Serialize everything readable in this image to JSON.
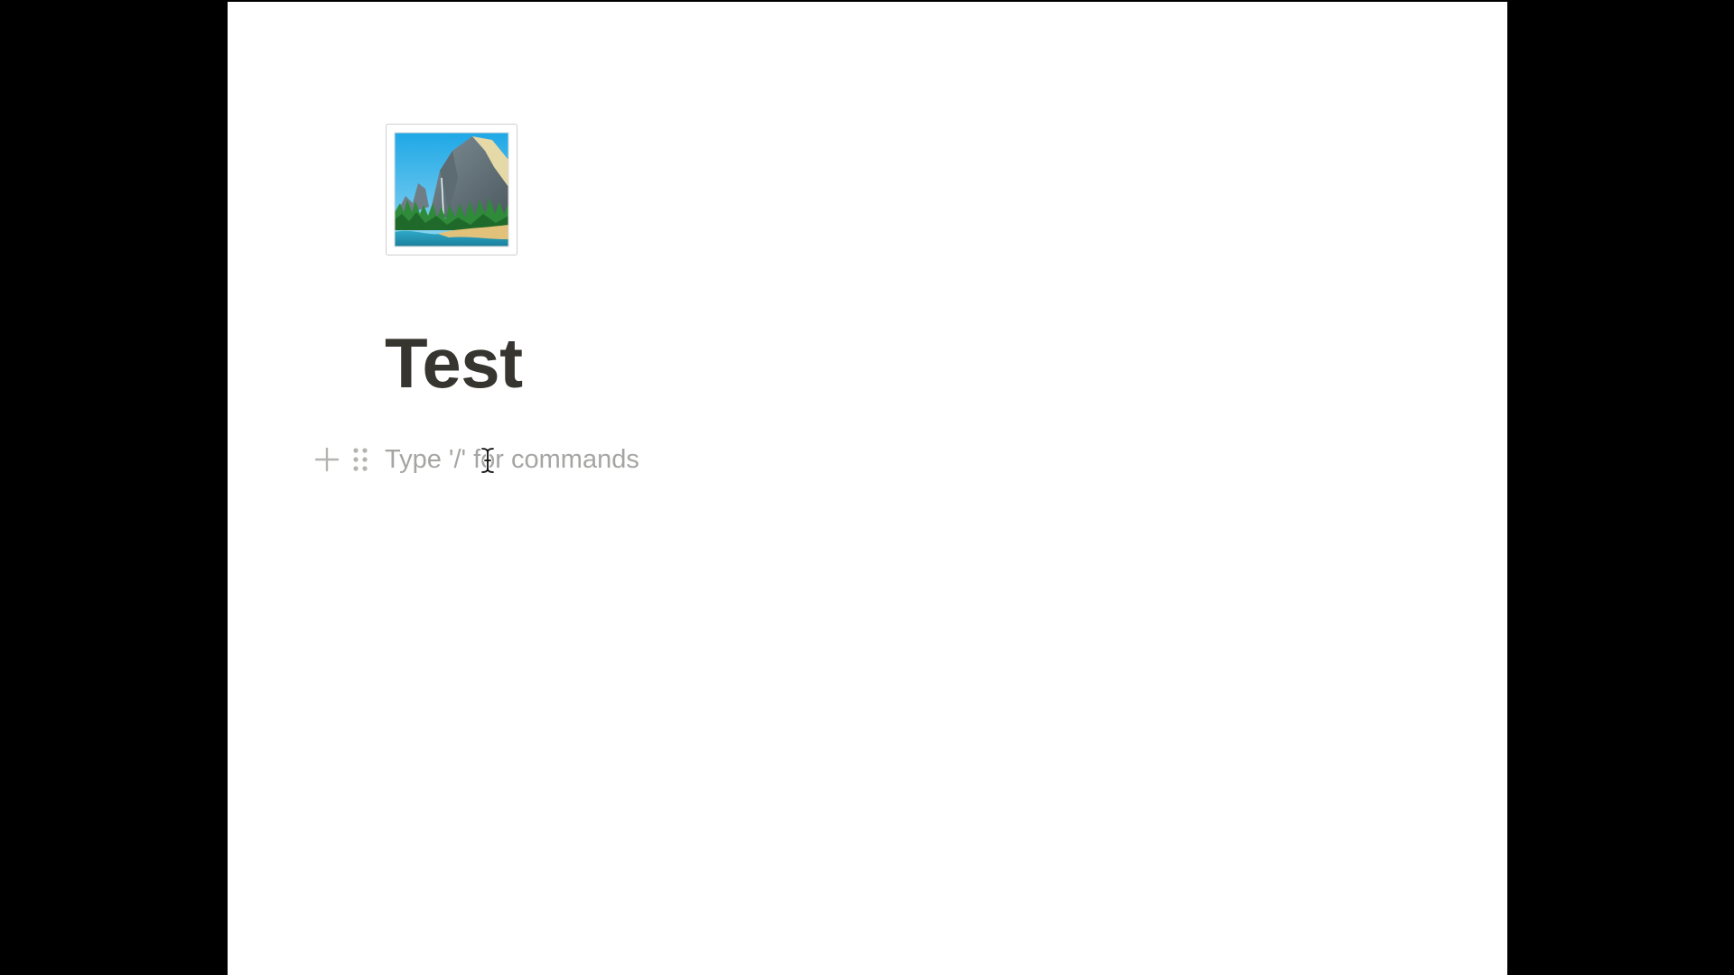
{
  "page": {
    "icon": "national-park-icon",
    "title": "Test"
  },
  "editor": {
    "placeholder": "Type '/' for commands",
    "add_block_icon": "plus-icon",
    "drag_handle_icon": "drag-handle-icon"
  },
  "colors": {
    "background": "#000000",
    "page": "#ffffff",
    "title": "#37352f",
    "placeholder": "#a5a5a3",
    "control": "#b4b4b1"
  }
}
